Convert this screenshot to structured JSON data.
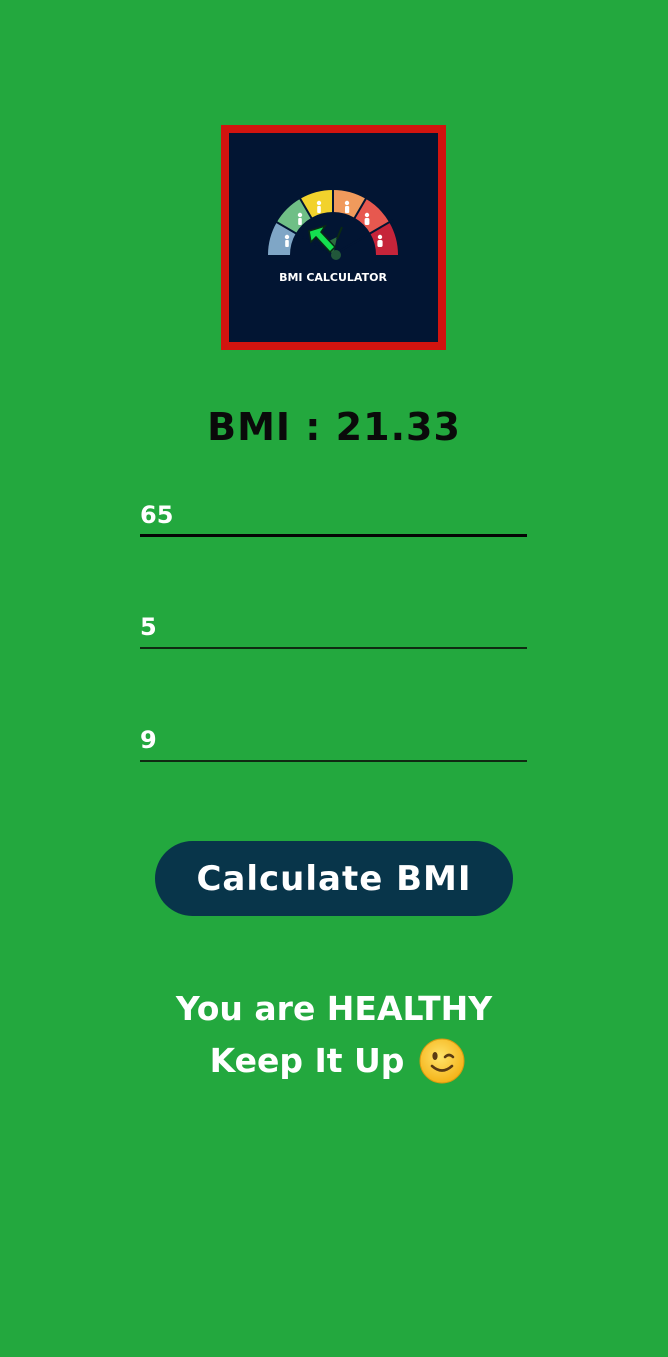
{
  "logo": {
    "caption": "BMI CALCULATOR",
    "frame_color": "#d2140f",
    "background_color": "#021533"
  },
  "result": {
    "text": "BMI : 21.33"
  },
  "inputs": {
    "weight": {
      "value": "65"
    },
    "height_feet": {
      "value": "5"
    },
    "height_inches": {
      "value": "9"
    }
  },
  "button": {
    "label": "Calculate BMI"
  },
  "message": {
    "line1": "You are HEALTHY",
    "line2": "Keep It Up",
    "emoji": "winking-face-emoji"
  },
  "colors": {
    "background": "#23a83e",
    "button": "#08354a"
  }
}
